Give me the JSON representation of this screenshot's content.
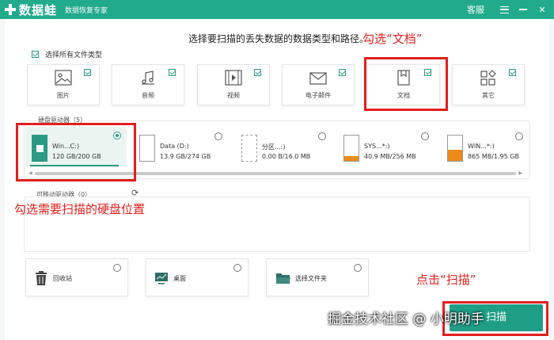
{
  "titlebar": {
    "app_name": "数据蛙",
    "subtitle": "数据恢复专家",
    "service": "客服"
  },
  "main": {
    "instruction": "选择要扫描的丢失数据的数据类型和路径。",
    "select_all_label": "选择所有文件类型",
    "file_types": [
      {
        "label": "图片",
        "icon": "image-icon",
        "checked": true
      },
      {
        "label": "音频",
        "icon": "music-icon",
        "checked": true
      },
      {
        "label": "视频",
        "icon": "video-icon",
        "checked": true
      },
      {
        "label": "电子邮件",
        "icon": "mail-icon",
        "checked": true
      },
      {
        "label": "文档",
        "icon": "document-icon",
        "checked": true
      },
      {
        "label": "其它",
        "icon": "other-icon",
        "checked": true
      }
    ],
    "hard_drives": {
      "title": "硬盘驱动器（5）",
      "drives": [
        {
          "name": "Win...C:)",
          "size": "120 GB/200 GB",
          "selected": true
        },
        {
          "name": "Data (D:)",
          "size": "13.9 GB/274 GB",
          "selected": false
        },
        {
          "name": "分区...:)",
          "size": "0.00  B/16.0 MB",
          "selected": false
        },
        {
          "name": "SYS...*:)",
          "size": "40.9 MB/256 MB",
          "selected": false
        },
        {
          "name": "WIN...*:)",
          "size": "865 MB/1.95 GB",
          "selected": false
        }
      ]
    },
    "removable": {
      "title": "可移动驱动器（0）"
    },
    "locations": [
      {
        "label": "回收站",
        "icon": "recycle-bin-icon"
      },
      {
        "label": "桌面",
        "icon": "desktop-icon"
      },
      {
        "label": "选择文件夹",
        "icon": "folder-icon"
      }
    ],
    "scan_button": "扫描"
  },
  "annotations": {
    "check_documents": "勾选“文档”",
    "check_drive": "勾选需要扫描的硬盘位置",
    "click_scan": "点击“扫描”"
  },
  "watermark": "掘金技术社区 @ 小明助手",
  "colors": {
    "brand": "#22aa8c",
    "accent": "#2a9b82",
    "scan_button": "#1f9e86",
    "annotation": "#e0201d",
    "drive_fill_teal": "#2a9b82",
    "drive_fill_orange": "#ec8a1a"
  }
}
